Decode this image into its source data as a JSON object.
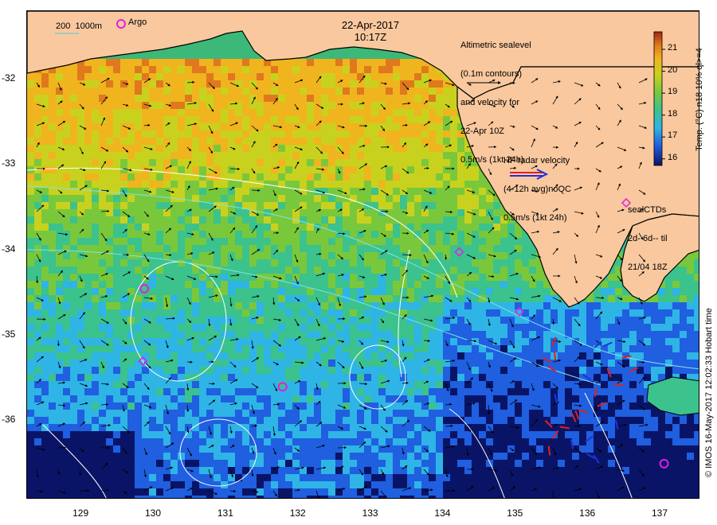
{
  "map": {
    "date_title": "22-Apr-2017",
    "time_title": "10:17Z",
    "lat_labels": [
      "-32",
      "-33",
      "-34",
      "-35",
      "-36"
    ],
    "lon_labels": [
      "129",
      "130",
      "131",
      "132",
      "133",
      "134",
      "135",
      "136",
      "137"
    ],
    "lat_values": [
      -32,
      -33,
      -34,
      -35,
      -36
    ],
    "lon_values": [
      129,
      130,
      131,
      132,
      133,
      134,
      135,
      136,
      137
    ],
    "lat_range": [
      -36.92,
      -31.2
    ],
    "lon_range": [
      128.25,
      137.55
    ]
  },
  "legend": {
    "depth_label": "200  1000m",
    "argo_label": "Argo",
    "altimetry_lines": [
      "Altimetric sealevel",
      "(0.1m contours)",
      "and velocity for",
      "22-Apr 10Z",
      "0.5m/s (1kt 24h)"
    ],
    "hf_radar_lines": [
      "HF radar velocity",
      "(4-12h avg)noQC",
      "0.5m/s (1kt 24h)"
    ],
    "seal_lines": [
      "sealCTDs",
      "2d- 6d-- til",
      "21/04 18Z"
    ]
  },
  "colorbar": {
    "ticks": [
      "21",
      "20",
      "19",
      "18",
      "17",
      "16"
    ],
    "tick_values": [
      21,
      20,
      19,
      18,
      17,
      16
    ],
    "range": [
      15.7,
      21.8
    ],
    "label": "Temp. (°C) n18 10% ql>=4",
    "colors": [
      "#0a1466",
      "#1f5fe0",
      "#2fb4e6",
      "#3cc28c",
      "#79c83c",
      "#c8d21e",
      "#f0b41e",
      "#e0781e",
      "#a02814"
    ]
  },
  "credit": "© IMOS 16-May-2017 12:02:33 Hobart time",
  "argo_floats": [
    {
      "lon": 129.87,
      "lat": -34.45
    },
    {
      "lon": 131.78,
      "lat": -35.6
    },
    {
      "lon": 137.05,
      "lat": -36.5
    }
  ],
  "seal_ctds": [
    {
      "lon": 134.22,
      "lat": -34.02
    },
    {
      "lon": 135.05,
      "lat": -34.72
    },
    {
      "lon": 129.85,
      "lat": -35.3
    }
  ],
  "colors": {
    "land": "#f9c89e",
    "coast": "#000000",
    "contour": "#ffffff",
    "argo": "#e020e0",
    "hf_radar": "#e02020"
  }
}
